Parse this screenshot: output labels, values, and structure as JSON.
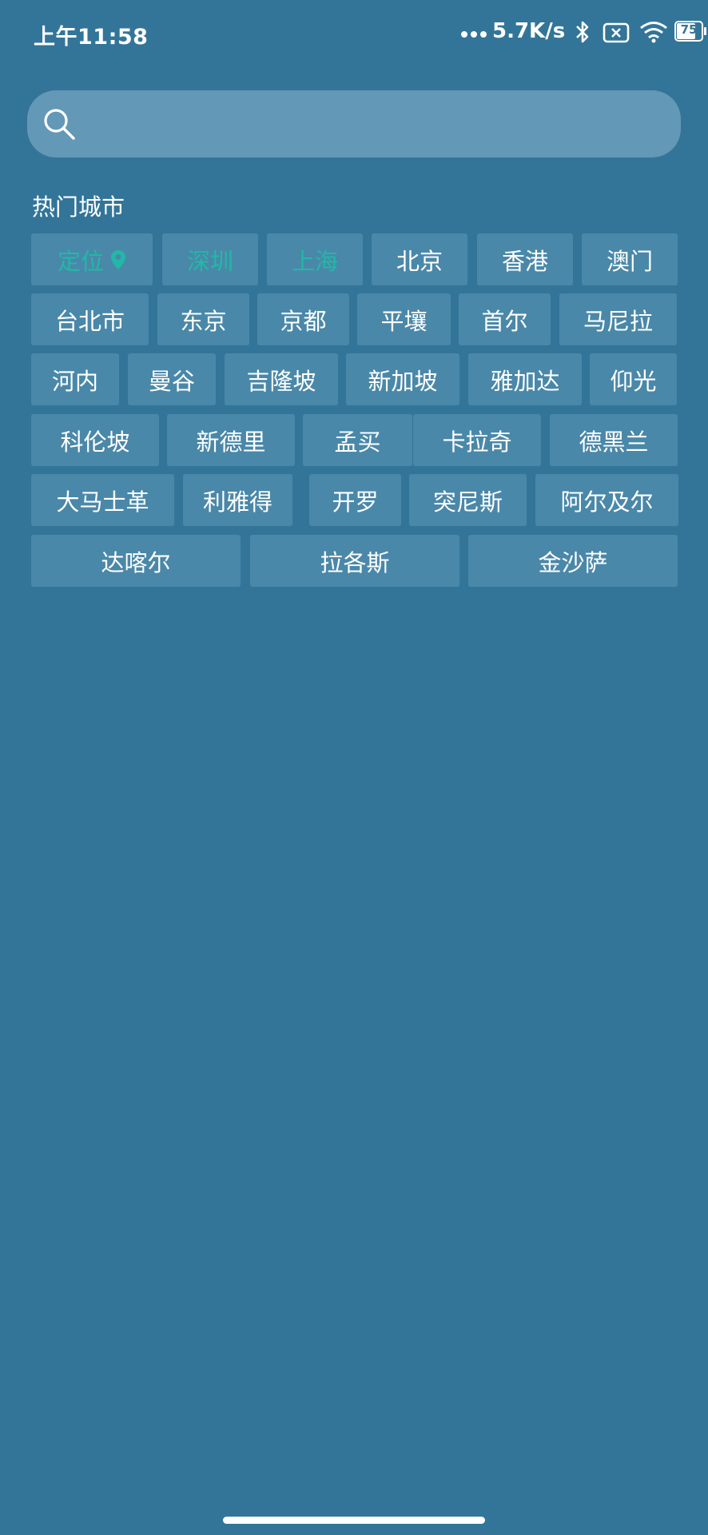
{
  "status_bar": {
    "time": "上午11:58",
    "net_speed": "5.7K/s",
    "battery": "75"
  },
  "search": {
    "placeholder": "",
    "value": ""
  },
  "hot_cities": {
    "title": "热门城市",
    "accent_color": "#22b8a8",
    "rows": [
      [
        {
          "label": "定位",
          "accent": true,
          "icon": "location-pin-icon"
        },
        {
          "label": "深圳",
          "accent": true
        },
        {
          "label": "上海",
          "accent": true
        },
        {
          "label": "北京"
        },
        {
          "label": "香港"
        },
        {
          "label": "澳门"
        }
      ],
      [
        {
          "label": "台北市"
        },
        {
          "label": "东京"
        },
        {
          "label": "京都"
        },
        {
          "label": "平壤"
        },
        {
          "label": "首尔"
        },
        {
          "label": "马尼拉"
        }
      ],
      [
        {
          "label": "河内"
        },
        {
          "label": "曼谷"
        },
        {
          "label": "吉隆坡"
        },
        {
          "label": "新加坡"
        },
        {
          "label": "雅加达"
        },
        {
          "label": "仰光"
        }
      ],
      [
        {
          "label": "科伦坡"
        },
        {
          "label": "新德里"
        },
        {
          "label": "孟买"
        },
        {
          "label": "卡拉奇"
        },
        {
          "label": "德黑兰"
        }
      ],
      [
        {
          "label": "大马士革"
        },
        {
          "label": "利雅得"
        },
        {
          "label": "开罗"
        },
        {
          "label": "突尼斯"
        },
        {
          "label": "阿尔及尔"
        }
      ],
      [
        {
          "label": "达喀尔"
        },
        {
          "label": "拉各斯"
        },
        {
          "label": "金沙萨"
        }
      ]
    ]
  }
}
